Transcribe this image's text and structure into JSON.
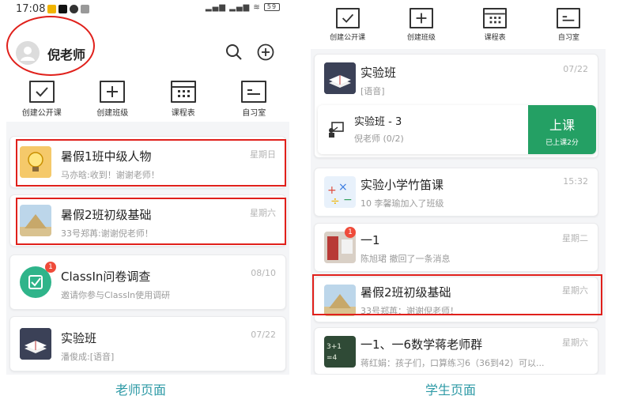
{
  "left_panel": {
    "status": {
      "time": "17:08",
      "battery": "59"
    },
    "header": {
      "name": "倪老师"
    },
    "actions": [
      {
        "label": "创建公开课",
        "icon": "check-box-icon"
      },
      {
        "label": "创建班级",
        "icon": "plus-box-icon"
      },
      {
        "label": "课程表",
        "icon": "calendar-grid-icon"
      },
      {
        "label": "自习室",
        "icon": "study-room-icon"
      }
    ],
    "chats": [
      {
        "title": "暑假1班中级人物",
        "preview": "马亦晗:收到！谢谢老师！",
        "time": "星期日",
        "thumb": "lightbulb-thumb"
      },
      {
        "title": "暑假2班初级基础",
        "preview": "33号郑苒:谢谢倪老师！",
        "time": "星期六",
        "thumb": "pyramid-thumb"
      },
      {
        "title": "ClassIn问卷调查",
        "preview": "邀请你参与ClassIn使用调研",
        "time": "08/10",
        "thumb": "survey-icon",
        "badge": "1"
      },
      {
        "title": "实验班",
        "preview": "潘俊成:[语音]",
        "time": "07/22",
        "thumb": "book-thumb"
      }
    ],
    "caption": "老师页面"
  },
  "right_panel": {
    "actions": [
      {
        "label": "创建公开课",
        "icon": "check-box-icon"
      },
      {
        "label": "创建班级",
        "icon": "plus-box-icon"
      },
      {
        "label": "课程表",
        "icon": "calendar-grid-icon"
      },
      {
        "label": "自习室",
        "icon": "study-room-icon"
      }
    ],
    "chats": [
      {
        "title": "实验班",
        "preview": "[语音]",
        "time": "07/22",
        "thumb": "book-thumb"
      },
      {
        "title": "实验小学竹笛课",
        "preview": "10 李馨瑜加入了班级",
        "time": "15:32",
        "thumb": "math-thumb"
      },
      {
        "title": "一1",
        "preview": "陈旭珺 撤回了一条消息",
        "time": "星期二",
        "thumb": "classroom-thumb",
        "badge": "1"
      },
      {
        "title": "暑假2班初级基础",
        "preview": "33号郑苒：谢谢倪老师！",
        "time": "星期六",
        "thumb": "pyramid-thumb"
      },
      {
        "title": "一1、一6数学蒋老师群",
        "preview": "蒋红娟：孩子们，口算练习6（36到42）可以...",
        "time": "星期六",
        "thumb": "chalkboard-thumb"
      }
    ],
    "class_session": {
      "title": "实验班 - 3",
      "teacher": "倪老师 (0/2)",
      "button_label": "上课",
      "button_sub": "已上课2分"
    },
    "caption": "学生页面"
  },
  "colors": {
    "accent_green": "#24a064",
    "highlight_red": "#e0201b",
    "caption_teal": "#2e9aa6",
    "badge_red": "#ef4b3a"
  }
}
